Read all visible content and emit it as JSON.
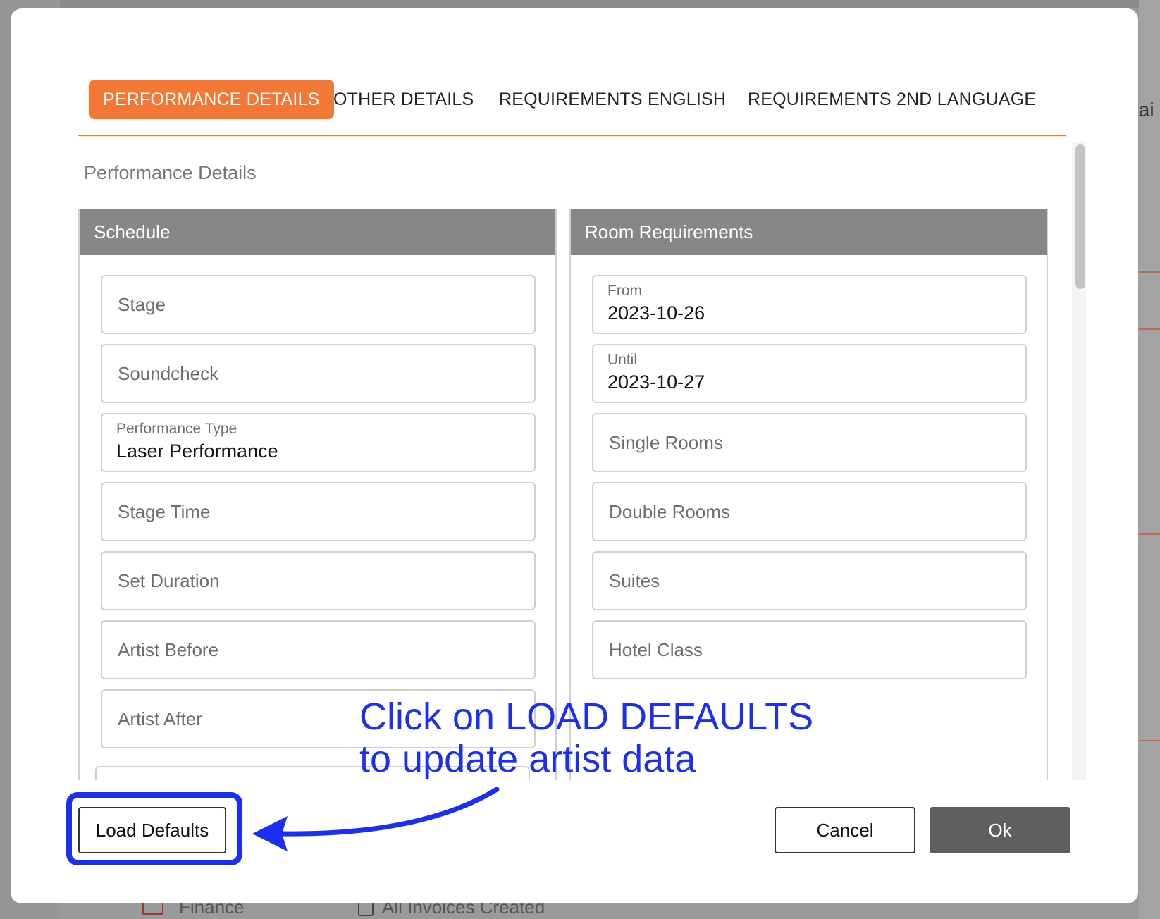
{
  "background": {
    "right_edge_text": "tai",
    "bottom_left_label": "Finance",
    "bottom_checkbox_label": "All Invoices Created"
  },
  "tabs": [
    {
      "label": "PERFORMANCE DETAILS",
      "active": true
    },
    {
      "label": "OTHER DETAILS",
      "active": false
    },
    {
      "label": "REQUIREMENTS ENGLISH",
      "active": false
    },
    {
      "label": "REQUIREMENTS 2ND LANGUAGE",
      "active": false
    }
  ],
  "section_title": "Performance Details",
  "schedule": {
    "header": "Schedule",
    "fields": [
      {
        "placeholder": "Stage"
      },
      {
        "placeholder": "Soundcheck"
      },
      {
        "label": "Performance Type",
        "value": "Laser Performance"
      },
      {
        "placeholder": "Stage Time"
      },
      {
        "placeholder": "Set Duration"
      },
      {
        "placeholder": "Artist Before"
      },
      {
        "placeholder": "Artist After"
      }
    ]
  },
  "room_requirements": {
    "header": "Room Requirements",
    "fields": [
      {
        "label": "From",
        "value": "2023-10-26"
      },
      {
        "label": "Until",
        "value": "2023-10-27"
      },
      {
        "placeholder": "Single Rooms"
      },
      {
        "placeholder": "Double Rooms"
      },
      {
        "placeholder": "Suites"
      },
      {
        "placeholder": "Hotel Class"
      }
    ]
  },
  "buttons": {
    "load_defaults": "Load Defaults",
    "cancel": "Cancel",
    "ok": "Ok"
  },
  "annotation": {
    "line1": "Click on LOAD DEFAULTS",
    "line2": "to update artist data",
    "color": "#1a2ff0"
  },
  "colors": {
    "accent": "#f37735",
    "header_gray": "#878787",
    "ok_button": "#5f5f5f"
  }
}
